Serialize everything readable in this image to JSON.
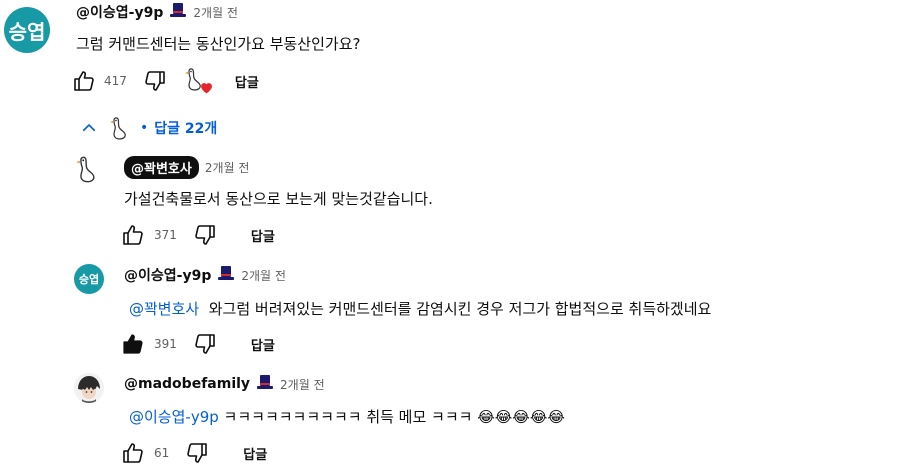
{
  "top_comment": {
    "avatar_text": "승엽",
    "author": "@이승엽-y9p",
    "time": "2개월 전",
    "text": "그럼 커맨드센터는 동산인가요 부동산인가요?",
    "likes": "417",
    "reply_label": "답글"
  },
  "replies_toggle": {
    "label": "답글 22개"
  },
  "replies": [
    {
      "author": "@꽉변호사",
      "time": "2개월 전",
      "text": "가설건축물로서 동산으로 보는게 맞는것같습니다.",
      "likes": "371",
      "reply_label": "답글"
    },
    {
      "avatar_text": "승엽",
      "author": "@이승엽-y9p",
      "time": "2개월 전",
      "mention": "@꽉변호사",
      "text": "와그럼 버려져있는 커맨드센터를 감염시킨 경우 저그가 합법적으로 취득하겠네요",
      "likes": "391",
      "reply_label": "답글"
    },
    {
      "author": "@madobefamily",
      "time": "2개월 전",
      "mention": "@이승엽-y9p",
      "text": "ㅋㅋㅋㅋㅋㅋㅋㅋㅋㅋ 취득 메모 ㅋㅋㅋ",
      "emojis": "😂😂😂😂😂",
      "likes": "61",
      "reply_label": "답글"
    }
  ],
  "colors": {
    "teal_avatar": "#179aa6",
    "link_blue": "#065fd4",
    "heart_red": "#e5252c"
  }
}
